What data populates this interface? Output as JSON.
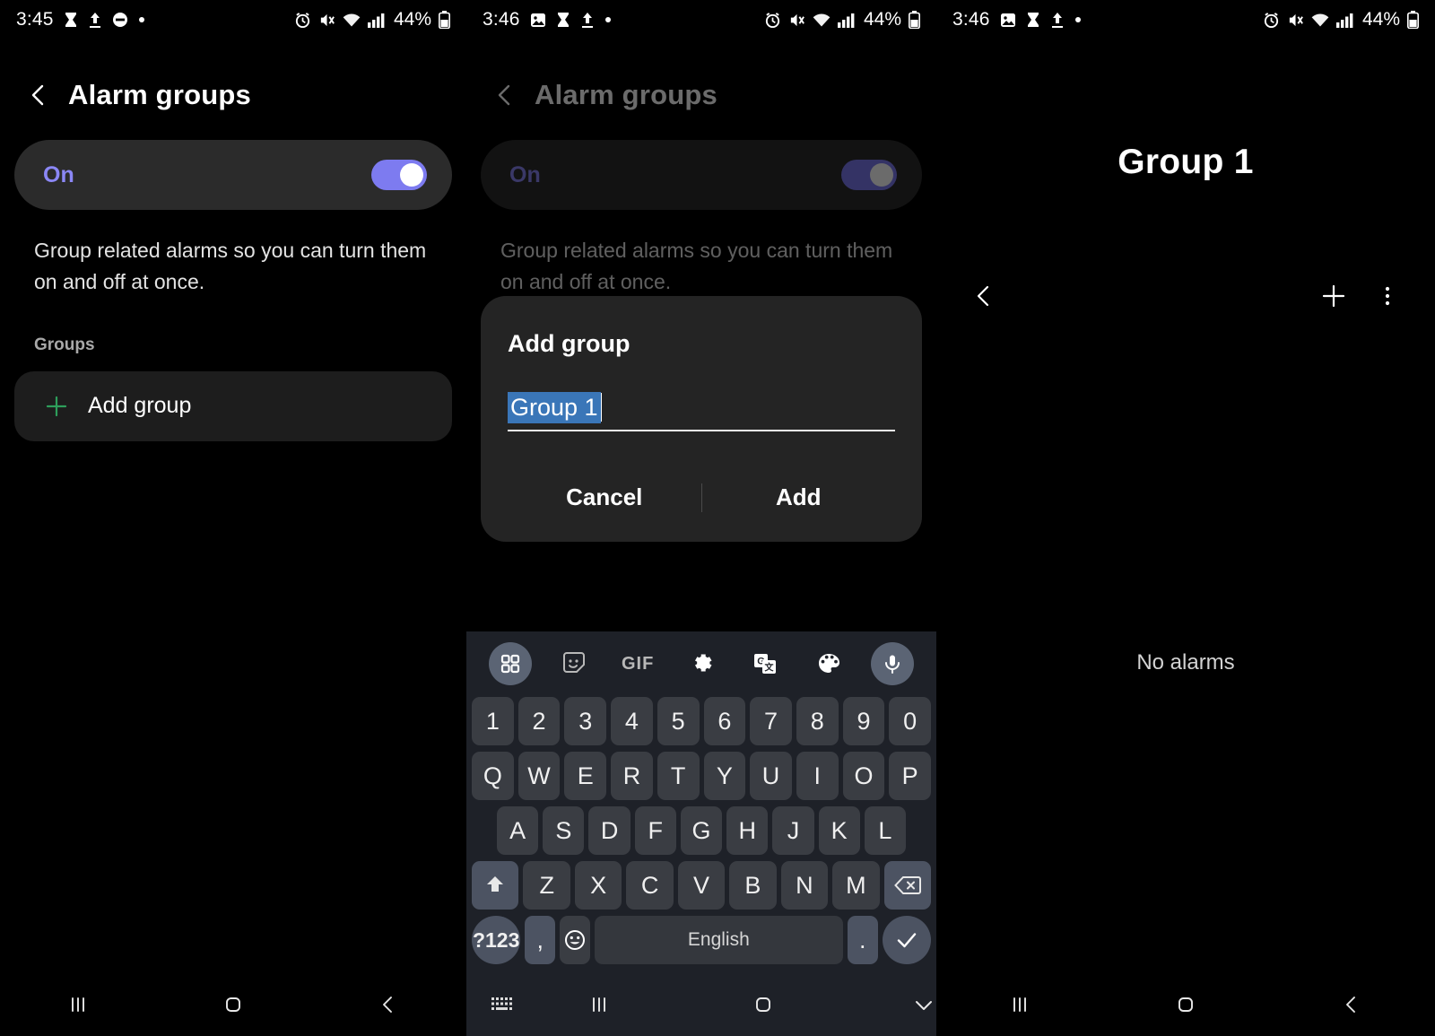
{
  "panels": [
    {
      "id": "alarm-groups-list",
      "status_bar": {
        "time": "3:45",
        "left_icons": [
          "hourglass-icon",
          "upload-icon",
          "dnd-icon",
          "dot-icon"
        ],
        "right_icons": [
          "alarm-icon",
          "mute-icon",
          "wifi-icon",
          "signal-icon"
        ],
        "battery_percent": "44%"
      },
      "app_bar": {
        "back_icon": "chevron-left-icon",
        "title": "Alarm groups"
      },
      "master_toggle": {
        "label": "On",
        "state": "on",
        "accent_color": "#7d7bf0"
      },
      "description": "Group related alarms so you can turn them on and off at once.",
      "section_label": "Groups",
      "add_group": {
        "icon": "plus-icon",
        "label": "Add group",
        "icon_color": "#2e9e5b"
      },
      "nav_bar": [
        "recents-icon",
        "home-icon",
        "back-icon"
      ]
    },
    {
      "id": "add-group-dialog",
      "status_bar": {
        "time": "3:46",
        "left_icons": [
          "image-icon",
          "hourglass-icon",
          "upload-icon",
          "dot-icon"
        ],
        "right_icons": [
          "alarm-icon",
          "mute-icon",
          "wifi-icon",
          "signal-icon"
        ],
        "battery_percent": "44%"
      },
      "app_bar": {
        "back_icon": "chevron-left-icon",
        "title": "Alarm groups"
      },
      "master_toggle": {
        "label": "On",
        "state": "on"
      },
      "description": "Group related alarms so you can turn them on and off at once.",
      "section_label": "Groups",
      "dialog": {
        "title": "Add group",
        "input_value": "Group 1",
        "input_selected": true,
        "selection_color": "#3a76b8",
        "cancel_label": "Cancel",
        "add_label": "Add"
      },
      "keyboard": {
        "toolbar": [
          "grid-icon",
          "sticker-icon",
          "gif-icon",
          "gear-icon",
          "translate-icon",
          "palette-icon",
          "microphone-icon"
        ],
        "gif_label": "GIF",
        "rows": [
          [
            "1",
            "2",
            "3",
            "4",
            "5",
            "6",
            "7",
            "8",
            "9",
            "0"
          ],
          [
            "Q",
            "W",
            "E",
            "R",
            "T",
            "Y",
            "U",
            "I",
            "O",
            "P"
          ],
          [
            "A",
            "S",
            "D",
            "F",
            "G",
            "H",
            "J",
            "K",
            "L"
          ],
          [
            "Z",
            "X",
            "C",
            "V",
            "B",
            "N",
            "M"
          ]
        ],
        "shift_icon": "shift-icon",
        "backspace_icon": "backspace-icon",
        "symbols_label": "?123",
        "comma_label": ",",
        "emoji_icon": "emoji-icon",
        "space_label": "English",
        "period_label": ".",
        "enter_icon": "checkmark-icon"
      },
      "nav_bar": [
        "keyboard-icon",
        "recents-icon",
        "home-icon",
        "hide-keyboard-icon"
      ]
    },
    {
      "id": "group-detail",
      "status_bar": {
        "time": "3:46",
        "left_icons": [
          "image-icon",
          "hourglass-icon",
          "upload-icon",
          "dot-icon"
        ],
        "right_icons": [
          "alarm-icon",
          "mute-icon",
          "wifi-icon",
          "signal-icon"
        ],
        "battery_percent": "44%"
      },
      "title": "Group 1",
      "actions": {
        "back_icon": "chevron-left-icon",
        "add_icon": "plus-icon",
        "more_icon": "more-vertical-icon"
      },
      "empty_state": "No alarms",
      "nav_bar": [
        "recents-icon",
        "home-icon",
        "back-icon"
      ]
    }
  ]
}
